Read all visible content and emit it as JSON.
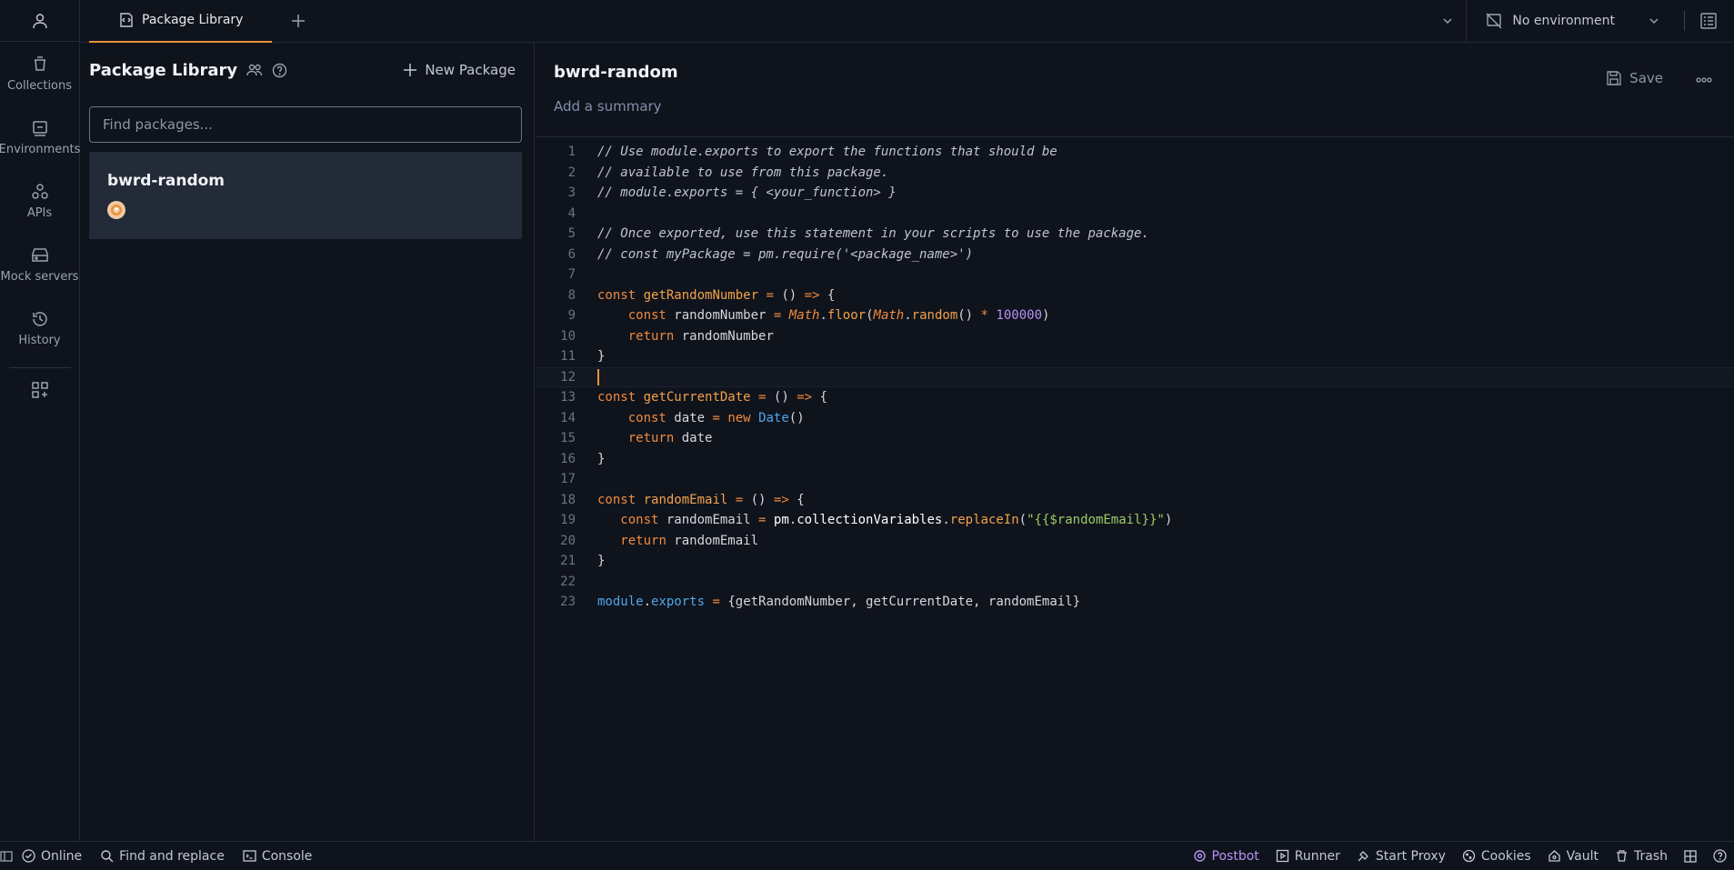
{
  "sidebar": {
    "items": [
      {
        "label": "Collections",
        "icon": "collections-icon"
      },
      {
        "label": "Environments",
        "icon": "environments-icon"
      },
      {
        "label": "APIs",
        "icon": "apis-icon"
      },
      {
        "label": "Mock servers",
        "icon": "mock-servers-icon"
      },
      {
        "label": "History",
        "icon": "history-icon"
      }
    ]
  },
  "header": {
    "tab_label": "Package Library",
    "environment": "No environment"
  },
  "library": {
    "title": "Package Library",
    "new_package_label": "New Package",
    "search_placeholder": "Find packages...",
    "packages": [
      {
        "name": "bwrd-random"
      }
    ]
  },
  "editor": {
    "package_name": "bwrd-random",
    "summary_placeholder": "Add a summary",
    "save_label": "Save",
    "active_line": 12,
    "lines": [
      "// Use module.exports to export the functions that should be",
      "// available to use from this package.",
      "// module.exports = { <your_function> }",
      "",
      "// Once exported, use this statement in your scripts to use the package.",
      "// const myPackage = pm.require('<package_name>')",
      "",
      "const getRandomNumber = () => {",
      "    const randomNumber = Math.floor(Math.random() * 100000)",
      "    return randomNumber",
      "}",
      "",
      "const getCurrentDate = () => {",
      "    const date = new Date()",
      "    return date",
      "}",
      "",
      "const randomEmail = () => {",
      "   const randomEmail = pm.collectionVariables.replaceIn(\"{{$randomEmail}}\")",
      "   return randomEmail",
      "}",
      "",
      "module.exports = {getRandomNumber, getCurrentDate, randomEmail}"
    ]
  },
  "statusbar": {
    "online": "Online",
    "find_replace": "Find and replace",
    "console": "Console",
    "postbot": "Postbot",
    "runner": "Runner",
    "start_proxy": "Start Proxy",
    "cookies": "Cookies",
    "vault": "Vault",
    "trash": "Trash"
  },
  "colors": {
    "accent": "#e8923a",
    "postbot": "#b894f6",
    "background": "#0f131c"
  }
}
